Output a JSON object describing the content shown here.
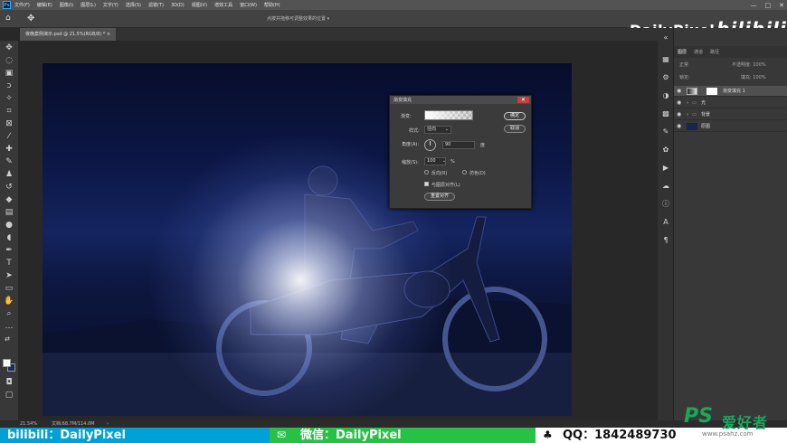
{
  "menubar": {
    "items": [
      "文件(F)",
      "编辑(E)",
      "图像(I)",
      "图层(L)",
      "文字(Y)",
      "选择(S)",
      "滤镜(T)",
      "3D(D)",
      "视图(V)",
      "增效工具",
      "窗口(W)",
      "帮助(H)"
    ],
    "ps_logo": "Ps",
    "window_controls": [
      "—",
      "□",
      "✕"
    ]
  },
  "options": {
    "hint": "点按并拖移可调整效果的位置 ▾"
  },
  "document_tab": {
    "label": "夜晚案例演示.psd @ 21.5%(RGB/8) *",
    "close": "×"
  },
  "brand": {
    "name": "DailyPixel",
    "bilibili": "bilibili"
  },
  "dialog": {
    "title": "渐变填充",
    "close": "✕",
    "gradient_label": "渐变:",
    "style_label": "样式:",
    "style_value": "径向",
    "angle_label": "角度(A):",
    "angle_value": "90",
    "angle_unit": "度",
    "scale_label": "缩放(S):",
    "scale_value": "100",
    "scale_unit": "%",
    "reverse_label": "反向(R)",
    "dither_label": "仿色(D)",
    "align_label": "与图层对齐(L)",
    "reset_label": "重置对齐",
    "ok_label": "确定",
    "cancel_label": "取消"
  },
  "layers": {
    "tabs": [
      "图层",
      "通道",
      "路径"
    ],
    "mode": "正常",
    "opacity": "不透明度: 100%",
    "fill": "填充: 100%",
    "lock": "锁定:",
    "items": [
      {
        "name": "渐变填充 1",
        "selected": true
      },
      {
        "name": "光",
        "type": "group"
      },
      {
        "name": "背景",
        "type": "group"
      },
      {
        "name": "原图",
        "type": "image"
      }
    ]
  },
  "status": {
    "zoom": "21.54%",
    "doc": "文档:68.7M/114.0M",
    "arrow": "›"
  },
  "footer": {
    "bili_text": "bilibili：DailyPixel",
    "wechat_text": "微信：DailyPixel",
    "qq_text": "QQ：1842489730"
  },
  "watermark": {
    "ps": "PS",
    "text": "爱好者",
    "url": "www.psahz.com"
  }
}
